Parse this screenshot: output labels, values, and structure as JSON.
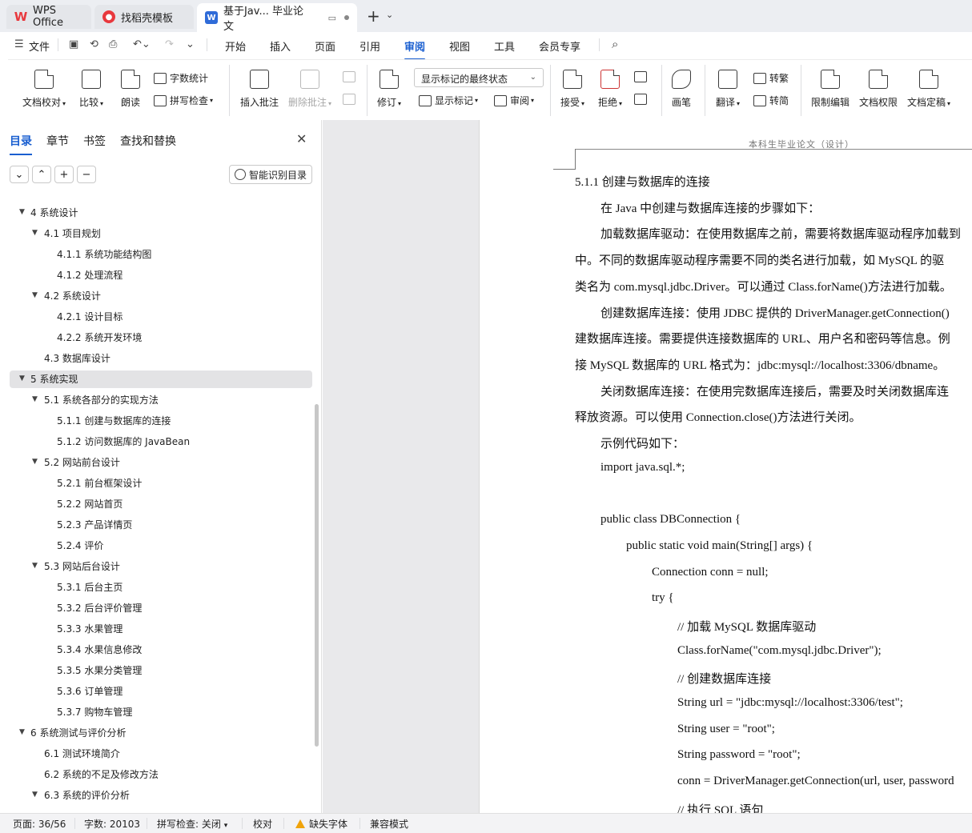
{
  "titlebar": {
    "tabs": [
      {
        "label": "WPS Office",
        "icon": "wps-logo-icon"
      },
      {
        "label": "找稻壳模板",
        "icon": "docer-icon"
      },
      {
        "label": "基于Jav... 毕业论文",
        "icon": "writer-icon",
        "active": true
      }
    ]
  },
  "menubar": {
    "file": "文件",
    "items": [
      "开始",
      "插入",
      "页面",
      "引用",
      "审阅",
      "视图",
      "工具",
      "会员专享"
    ],
    "active": "审阅"
  },
  "ribbon": {
    "doc_check": "文档校对",
    "compare": "比较",
    "read_aloud": "朗读",
    "word_count": "字数统计",
    "spell_check": "拼写检查",
    "insert_comment": "插入批注",
    "delete_comment": "删除批注",
    "track_changes": "修订",
    "markup_select": "显示标记的最终状态",
    "show_markup": "显示标记",
    "review_pane": "审阅",
    "accept": "接受",
    "reject": "拒绝",
    "pen": "画笔",
    "translate": "翻译",
    "to_traditional": "转繁",
    "to_simplified": "转简",
    "restrict_edit": "限制编辑",
    "doc_permission": "文档权限",
    "finalize": "文档定稿"
  },
  "leftpane": {
    "tabs": [
      "目录",
      "章节",
      "书签",
      "查找和替换"
    ],
    "active_tab": "目录",
    "smart_toc": "智能识别目录",
    "toc": [
      {
        "text": "4  系统设计",
        "level": 1,
        "expanded": true
      },
      {
        "text": "4.1  项目规划",
        "level": 2,
        "expanded": true
      },
      {
        "text": "4.1.1  系统功能结构图",
        "level": 3
      },
      {
        "text": "4.1.2  处理流程",
        "level": 3
      },
      {
        "text": "4.2  系统设计",
        "level": 2,
        "expanded": true
      },
      {
        "text": "4.2.1  设计目标",
        "level": 3
      },
      {
        "text": "4.2.2  系统开发环境",
        "level": 3
      },
      {
        "text": "4.3  数据库设计",
        "level": 2
      },
      {
        "text": "5  系统实现",
        "level": 1,
        "expanded": true,
        "selected": true
      },
      {
        "text": "5.1  系统各部分的实现方法",
        "level": 2,
        "expanded": true
      },
      {
        "text": "5.1.1  创建与数据库的连接",
        "level": 3
      },
      {
        "text": "5.1.2  访问数据库的 JavaBean",
        "level": 3
      },
      {
        "text": "5.2  网站前台设计",
        "level": 2,
        "expanded": true
      },
      {
        "text": "5.2.1 前台框架设计",
        "level": 3
      },
      {
        "text": "5.2.2  网站首页",
        "level": 3
      },
      {
        "text": "5.2.3  产品详情页",
        "level": 3
      },
      {
        "text": "5.2.4  评价",
        "level": 3
      },
      {
        "text": "5.3 网站后台设计",
        "level": 2,
        "expanded": true
      },
      {
        "text": "5.3.1  后台主页",
        "level": 3
      },
      {
        "text": "5.3.2  后台评价管理",
        "level": 3
      },
      {
        "text": "5.3.3  水果管理",
        "level": 3
      },
      {
        "text": "5.3.4  水果信息修改",
        "level": 3
      },
      {
        "text": "5.3.5  水果分类管理",
        "level": 3
      },
      {
        "text": "5.3.6  订单管理",
        "level": 3
      },
      {
        "text": "5.3.7  购物车管理",
        "level": 3
      },
      {
        "text": "6  系统测试与评价分析",
        "level": 1,
        "expanded": true
      },
      {
        "text": "6.1  测试环境简介",
        "level": 2
      },
      {
        "text": "6.2  系统的不足及修改方法",
        "level": 2
      },
      {
        "text": "6.3  系统的评价分析",
        "level": 2,
        "expanded": true
      }
    ]
  },
  "document": {
    "header": "本科生毕业论文（设计）",
    "lines": [
      {
        "text": "5.1.1  创建与数据库的连接",
        "indent": 0
      },
      {
        "text": "在 Java 中创建与数据库连接的步骤如下：",
        "indent": 1
      },
      {
        "text": "加载数据库驱动：在使用数据库之前，需要将数据库驱动程序加载到",
        "indent": 1
      },
      {
        "text": "中。不同的数据库驱动程序需要不同的类名进行加载，如 MySQL 的驱",
        "indent": 0
      },
      {
        "text": "类名为 com.mysql.jdbc.Driver。可以通过 Class.forName()方法进行加载。",
        "indent": 0
      },
      {
        "text": "创建数据库连接：使用 JDBC 提供的 DriverManager.getConnection()",
        "indent": 1
      },
      {
        "text": "建数据库连接。需要提供连接数据库的 URL、用户名和密码等信息。例",
        "indent": 0
      },
      {
        "text": "接 MySQL 数据库的 URL 格式为：jdbc:mysql://localhost:3306/dbname。",
        "indent": 0
      },
      {
        "text": "关闭数据库连接：在使用完数据库连接后，需要及时关闭数据库连",
        "indent": 1
      },
      {
        "text": "释放资源。可以使用 Connection.close()方法进行关闭。",
        "indent": 0
      },
      {
        "text": "示例代码如下：",
        "indent": 1
      },
      {
        "text": "import java.sql.*;",
        "indent": 1
      },
      {
        "text": "",
        "indent": 1
      },
      {
        "text": "public class DBConnection {",
        "indent": 1
      },
      {
        "text": "public static void main(String[] args) {",
        "indent": 2
      },
      {
        "text": "Connection conn = null;",
        "indent": 3
      },
      {
        "text": "try {",
        "indent": 3
      },
      {
        "text": "//  加载 MySQL 数据库驱动",
        "indent": 4
      },
      {
        "text": "Class.forName(\"com.mysql.jdbc.Driver\");",
        "indent": 4
      },
      {
        "text": "//  创建数据库连接",
        "indent": 4
      },
      {
        "text": "String url = \"jdbc:mysql://localhost:3306/test\";",
        "indent": 4
      },
      {
        "text": "String user = \"root\";",
        "indent": 4
      },
      {
        "text": "String password = \"root\";",
        "indent": 4
      },
      {
        "text": "conn = DriverManager.getConnection(url, user, password",
        "indent": 4
      },
      {
        "text": "//  执行 SQL 语句",
        "indent": 4
      }
    ]
  },
  "statusbar": {
    "page": "页面: 36/56",
    "words": "字数: 20103",
    "spell": "拼写检查: 关闭",
    "proof": "校对",
    "missing_font": "缺失字体",
    "compat": "兼容模式"
  },
  "colors": {
    "accent": "#1a5fd0",
    "wps_red": "#e8383d",
    "warning": "#f0a30a"
  }
}
